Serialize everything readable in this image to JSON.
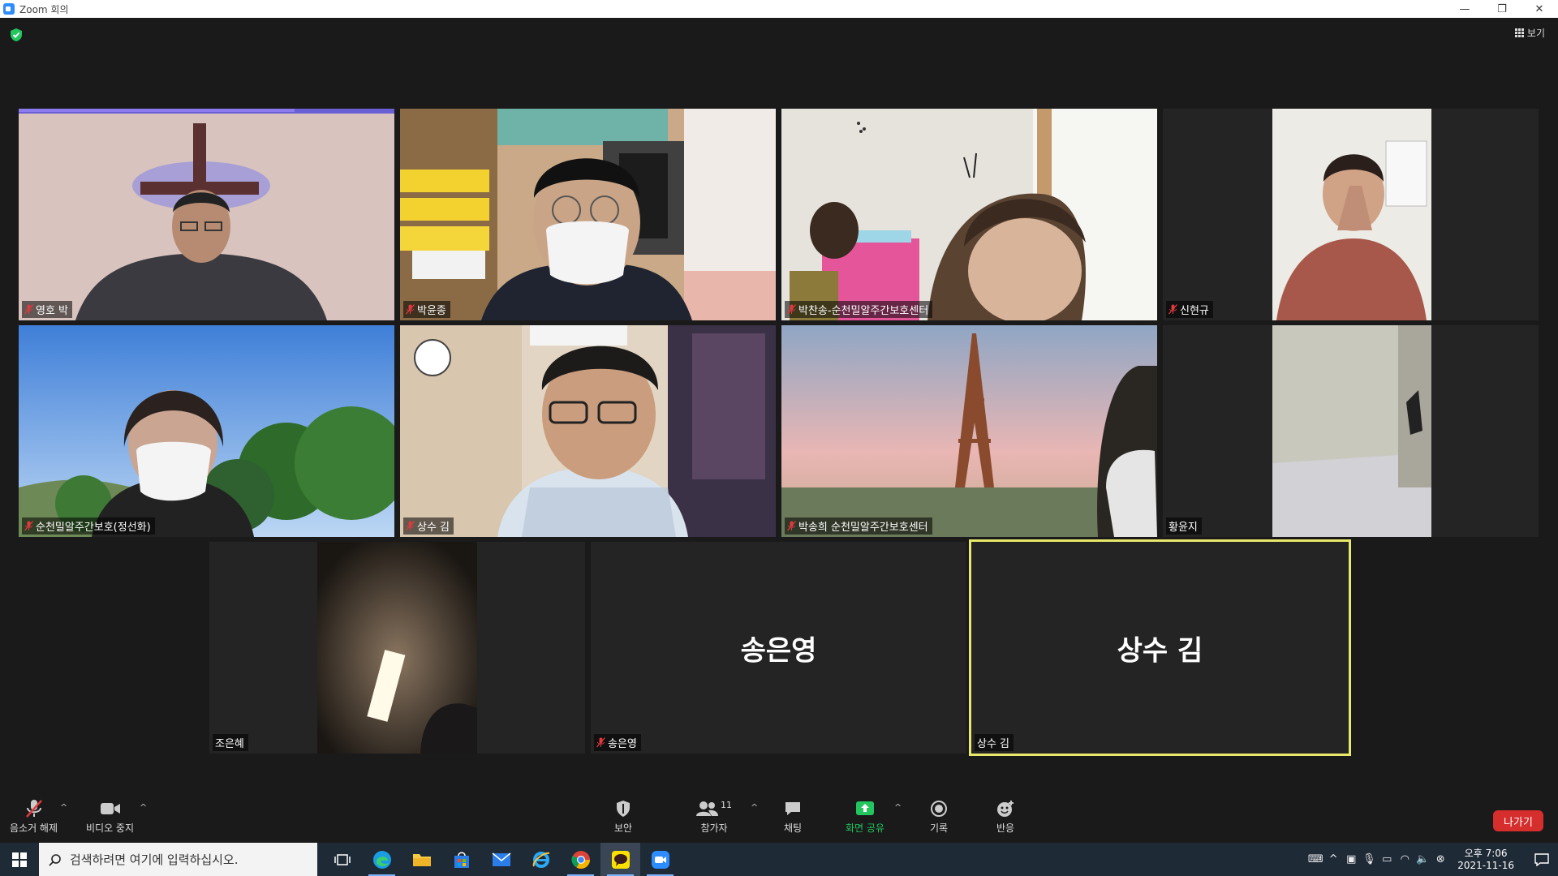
{
  "window": {
    "title": "Zoom 회의",
    "minimize": "—",
    "restore": "❐",
    "close": "✕"
  },
  "header": {
    "view_label": "보기"
  },
  "participants": [
    {
      "name": "영호 박",
      "muted": true,
      "video": "cross"
    },
    {
      "name": "박윤종",
      "muted": true,
      "video": "glasses"
    },
    {
      "name": "박찬송-순천밀알주간보호센터",
      "muted": true,
      "video": "girl"
    },
    {
      "name": "신현규",
      "muted": true,
      "video": "pray"
    },
    {
      "name": "순천밀알주간보호(정선화)",
      "muted": true,
      "video": "trees"
    },
    {
      "name": "상수 김",
      "muted": true,
      "video": "man"
    },
    {
      "name": "박송희 순천밀알주간보호센터",
      "muted": true,
      "video": "eiffel"
    },
    {
      "name": "황윤지",
      "muted": false,
      "video": "room"
    },
    {
      "name": "조은혜",
      "muted": false,
      "video": "light"
    },
    {
      "name": "송은영",
      "muted": true,
      "video": "none",
      "big_name": "송은영"
    },
    {
      "name": "상수 김",
      "muted": false,
      "video": "none",
      "big_name": "상수 김",
      "active_speaker": true
    }
  ],
  "toolbar": {
    "unmute_label": "음소거 해제",
    "stop_video_label": "비디오 중지",
    "security_label": "보안",
    "participants_label": "참가자",
    "participants_count": "11",
    "chat_label": "채팅",
    "share_label": "화면 공유",
    "record_label": "기록",
    "reactions_label": "반응",
    "leave_label": "나가기",
    "caret": "^"
  },
  "taskbar": {
    "search_placeholder": "검색하려면 여기에 입력하십시오.",
    "time": "오후 7:06",
    "date": "2021-11-16",
    "tray_up": "^"
  },
  "colors": {
    "active_speaker_border": "#e8e86a",
    "share_green": "#22c55e",
    "leave_red": "#d62d2d",
    "muted_red": "#e0393e"
  }
}
